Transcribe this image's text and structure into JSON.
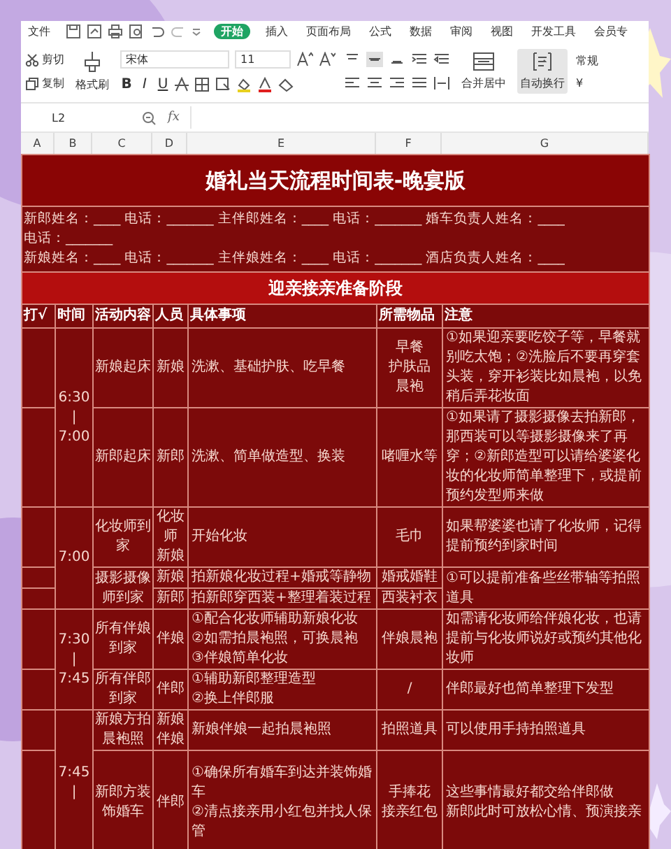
{
  "ribbon_tabs": [
    {
      "label": "文件",
      "selected": false
    },
    {
      "label": "开始",
      "selected": true
    },
    {
      "label": "插入",
      "selected": false
    },
    {
      "label": "页面布局",
      "selected": false
    },
    {
      "label": "公式",
      "selected": false
    },
    {
      "label": "数据",
      "selected": false
    },
    {
      "label": "审阅",
      "selected": false
    },
    {
      "label": "视图",
      "selected": false
    },
    {
      "label": "开发工具",
      "selected": false
    },
    {
      "label": "会员专",
      "selected": false
    }
  ],
  "toolbar": {
    "cut": "剪切",
    "copy": "复制",
    "format_painter": "格式刷",
    "font": "宋体",
    "size": "11",
    "text_buttons": [
      "B",
      "I",
      "U"
    ],
    "merge": "合并居中",
    "wrap": "自动换行",
    "wrap_active": true,
    "number_format": "常规",
    "currency": "¥"
  },
  "formula_bar": {
    "cell": "L2",
    "fx": "fx"
  },
  "columns": [
    "A",
    "B",
    "C",
    "D",
    "E",
    "F",
    "G"
  ],
  "sheet": {
    "title": "婚礼当天流程时间表-晚宴版",
    "info_lines": [
      "新郎姓名：____ 电话：_______ 主伴郎姓名：____ 电话：_______ 婚车负责人姓名：____",
      "电话：_______",
      "新娘姓名：____ 电话：_______ 主伴娘姓名：____ 电话：_______ 酒店负责人姓名：____"
    ],
    "section": "迎亲接亲准备阶段",
    "headers": [
      "打√",
      "时间",
      "活动内容",
      "人员",
      "具体事项",
      "所需物品",
      "注意"
    ],
    "slots": [
      {
        "time": [
          "6:30",
          "|",
          "7:00"
        ],
        "activities": [
          {
            "activity": [
              "新娘起床"
            ],
            "entries": [
              {
                "staff": [
                  "新娘"
                ],
                "task": [
                  "洗漱、基础护肤、吃早餐"
                ],
                "items": [
                  "早餐",
                  "护肤品",
                  "晨袍"
                ]
              }
            ],
            "note": [
              "①如果迎亲要吃饺子等，早餐就别吃太饱；②洗脸后不要再穿套头装，穿开衫装比如晨袍，以免稍后弄花妆面"
            ]
          },
          {
            "activity": [
              "新郎起床"
            ],
            "entries": [
              {
                "staff": [
                  "新郎"
                ],
                "task": [
                  "洗漱、简单做造型、换装"
                ],
                "items": [
                  "啫喱水等"
                ]
              }
            ],
            "note": [
              "①如果请了摄影摄像去拍新郎，那西装可以等摄影摄像来了再穿；②新郎造型可以请给婆婆化妆的化妆师简单整理下，或提前预约发型师来做"
            ]
          }
        ]
      },
      {
        "time": [
          "7:00"
        ],
        "activities": [
          {
            "activity": [
              "化妆师到家"
            ],
            "entries": [
              {
                "staff": [
                  "化妆师",
                  "新娘"
                ],
                "task": [
                  "开始化妆"
                ],
                "items": [
                  "毛巾"
                ]
              }
            ],
            "note": [
              "如果帮婆婆也请了化妆师，记得提前预约到家时间"
            ]
          },
          {
            "activity": [
              "摄影摄像师到家"
            ],
            "entries": [
              {
                "staff": [
                  "新娘"
                ],
                "task": [
                  "拍新娘化妆过程+婚戒等静物"
                ],
                "items": [
                  "婚戒婚鞋"
                ]
              },
              {
                "staff": [
                  "新郎"
                ],
                "task": [
                  "拍新郎穿西装+整理着装过程"
                ],
                "items": [
                  "西装衬衣"
                ]
              }
            ],
            "note": [
              "①可以提前准备些丝带轴等拍照道具"
            ]
          }
        ]
      },
      {
        "time": [
          "7:30",
          "|",
          "7:45"
        ],
        "activities": [
          {
            "activity": [
              "所有伴娘到家"
            ],
            "entries": [
              {
                "staff": [
                  "伴娘"
                ],
                "task": [
                  "①配合化妆师辅助新娘化妆",
                  "②如需拍晨袍照，可换晨袍",
                  "③伴娘简单化妆"
                ],
                "items": [
                  "伴娘晨袍"
                ]
              }
            ],
            "note": [
              "如需请化妆师给伴娘化妆，也请提前与化妆师说好或预约其他化妆师"
            ]
          },
          {
            "activity": [
              "所有伴郎到家"
            ],
            "entries": [
              {
                "staff": [
                  "伴郎"
                ],
                "task": [
                  "①辅助新郎整理造型",
                  "②换上伴郎服"
                ],
                "items": [
                  "/"
                ]
              }
            ],
            "note": [
              "伴郎最好也简单整理下发型"
            ]
          }
        ]
      },
      {
        "time": [
          "7:45",
          "|"
        ],
        "activities": [
          {
            "activity": [
              "新娘方拍晨袍照"
            ],
            "entries": [
              {
                "staff": [
                  "新娘",
                  "伴娘"
                ],
                "task": [
                  "新娘伴娘一起拍晨袍照"
                ],
                "items": [
                  "拍照道具"
                ]
              }
            ],
            "note": [
              "可以使用手持拍照道具"
            ]
          },
          {
            "activity": [
              "新郎方装饰婚车"
            ],
            "entries": [
              {
                "staff": [
                  "伴郎"
                ],
                "task": [
                  "①确保所有婚车到达并装饰婚车",
                  "②清点接亲用小红包并找人保管"
                ],
                "items": [
                  "手捧花",
                  "接亲红包"
                ]
              }
            ],
            "note": [
              "这些事情最好都交给伴郎做",
              "新郎此时可放松心情、预演接亲"
            ]
          }
        ]
      }
    ]
  }
}
